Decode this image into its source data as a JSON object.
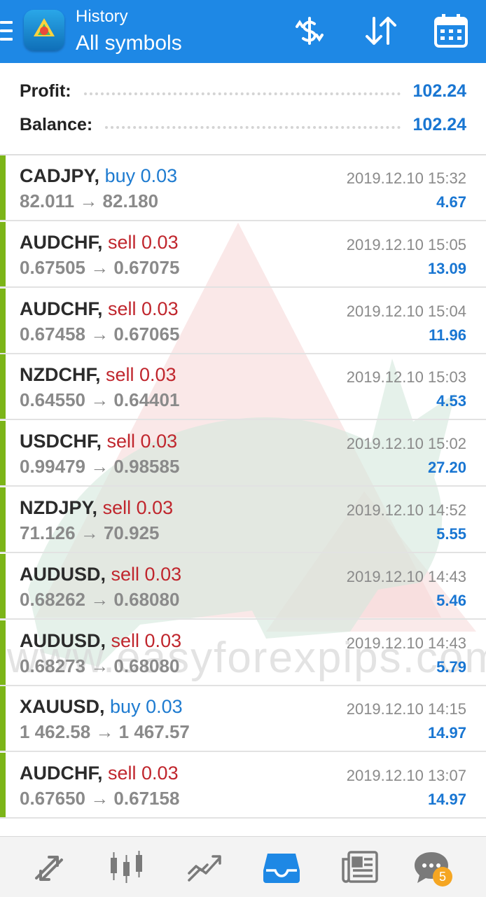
{
  "header": {
    "title": "History",
    "subtitle": "All symbols",
    "icons": [
      "menu-icon",
      "app-logo-icon",
      "currency-exchange-icon",
      "sort-icon",
      "calendar-icon"
    ]
  },
  "summary": {
    "profit_label": "Profit:",
    "profit_value": "102.24",
    "balance_label": "Balance:",
    "balance_value": "102.24"
  },
  "deals": [
    {
      "symbol": "CADJPY,",
      "side": "buy 0.03",
      "type": "buy",
      "prices": "82.011 → 82.180",
      "time": "2019.12.10 15:32",
      "profit": "4.67"
    },
    {
      "symbol": "AUDCHF,",
      "side": "sell 0.03",
      "type": "sell",
      "prices": "0.67505 → 0.67075",
      "time": "2019.12.10 15:05",
      "profit": "13.09"
    },
    {
      "symbol": "AUDCHF,",
      "side": "sell 0.03",
      "type": "sell",
      "prices": "0.67458 → 0.67065",
      "time": "2019.12.10 15:04",
      "profit": "11.96"
    },
    {
      "symbol": "NZDCHF,",
      "side": "sell 0.03",
      "type": "sell",
      "prices": "0.64550 → 0.64401",
      "time": "2019.12.10 15:03",
      "profit": "4.53"
    },
    {
      "symbol": "USDCHF,",
      "side": "sell 0.03",
      "type": "sell",
      "prices": "0.99479 → 0.98585",
      "time": "2019.12.10 15:02",
      "profit": "27.20"
    },
    {
      "symbol": "NZDJPY,",
      "side": "sell 0.03",
      "type": "sell",
      "prices": "71.126 → 70.925",
      "time": "2019.12.10 14:52",
      "profit": "5.55"
    },
    {
      "symbol": "AUDUSD,",
      "side": "sell 0.03",
      "type": "sell",
      "prices": "0.68262 → 0.68080",
      "time": "2019.12.10 14:43",
      "profit": "5.46"
    },
    {
      "symbol": "AUDUSD,",
      "side": "sell 0.03",
      "type": "sell",
      "prices": "0.68273 → 0.68080",
      "time": "2019.12.10 14:43",
      "profit": "5.79"
    },
    {
      "symbol": "XAUUSD,",
      "side": "buy 0.03",
      "type": "buy",
      "prices": "1 462.58 → 1 467.57",
      "time": "2019.12.10 14:15",
      "profit": "14.97"
    },
    {
      "symbol": "AUDCHF,",
      "side": "sell 0.03",
      "type": "sell",
      "prices": "0.67650 → 0.67158",
      "time": "2019.12.10 13:07",
      "profit": "14.97"
    }
  ],
  "watermark_text": "www.easyforexpips.com",
  "bottom_nav": {
    "items": [
      "quotes-icon",
      "chart-icon",
      "trade-icon",
      "history-icon",
      "news-icon",
      "chat-icon"
    ],
    "active": "history-icon",
    "chat_badge": "5"
  },
  "colors": {
    "accent": "#1e88e5",
    "profit": "#1976d2",
    "buy": "#1e7bd0",
    "sell": "#c0262d",
    "deal_bar": "#7cb518"
  }
}
